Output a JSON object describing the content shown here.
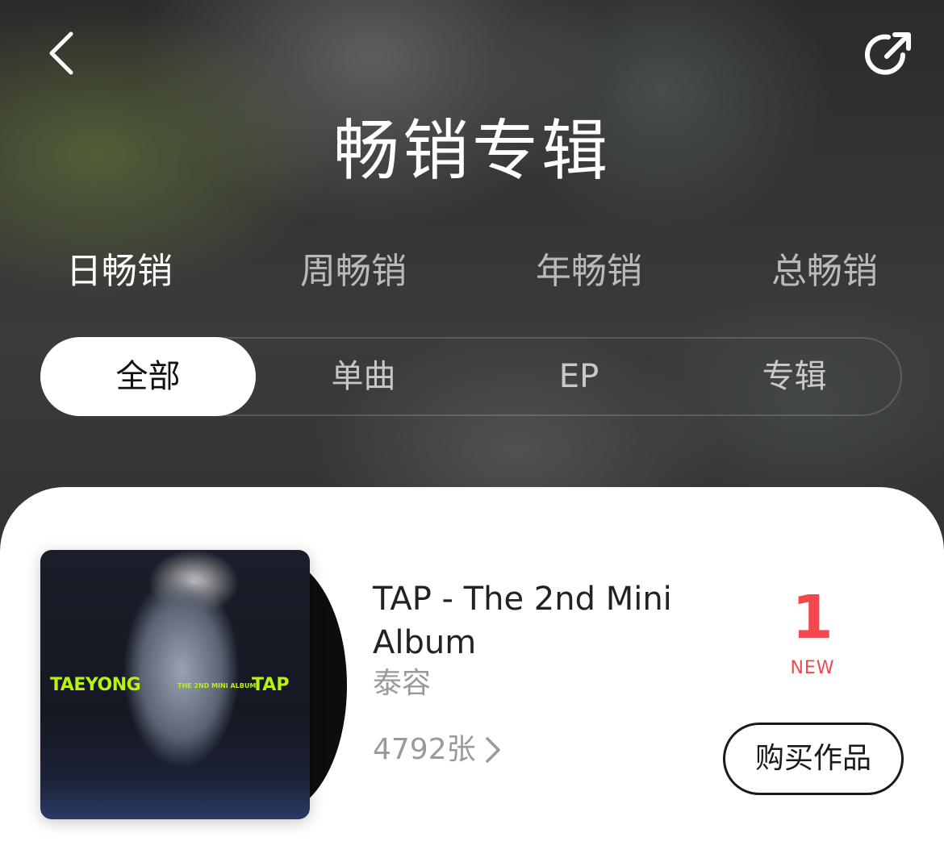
{
  "header": {
    "title": "畅销专辑",
    "back_icon": "chevron-left-icon",
    "share_icon": "share-icon"
  },
  "period_tabs": [
    {
      "label": "日畅销",
      "active": true
    },
    {
      "label": "周畅销",
      "active": false
    },
    {
      "label": "年畅销",
      "active": false
    },
    {
      "label": "总畅销",
      "active": false
    }
  ],
  "type_filters": [
    {
      "label": "全部",
      "active": true
    },
    {
      "label": "单曲",
      "active": false
    },
    {
      "label": "EP",
      "active": false
    },
    {
      "label": "专辑",
      "active": false
    }
  ],
  "albums": [
    {
      "title": "TAP - The 2nd Mini Album",
      "artist": "泰容",
      "sales": "4792张",
      "rank": "1",
      "rank_badge": "NEW",
      "buy_label": "购买作品",
      "cover_text": {
        "artist": "TAEYONG",
        "sub": "THE 2ND MINI ALBUM",
        "title": "TAP"
      }
    }
  ],
  "colors": {
    "rank": "#f0484d",
    "cover_text": "#b9f20f"
  }
}
